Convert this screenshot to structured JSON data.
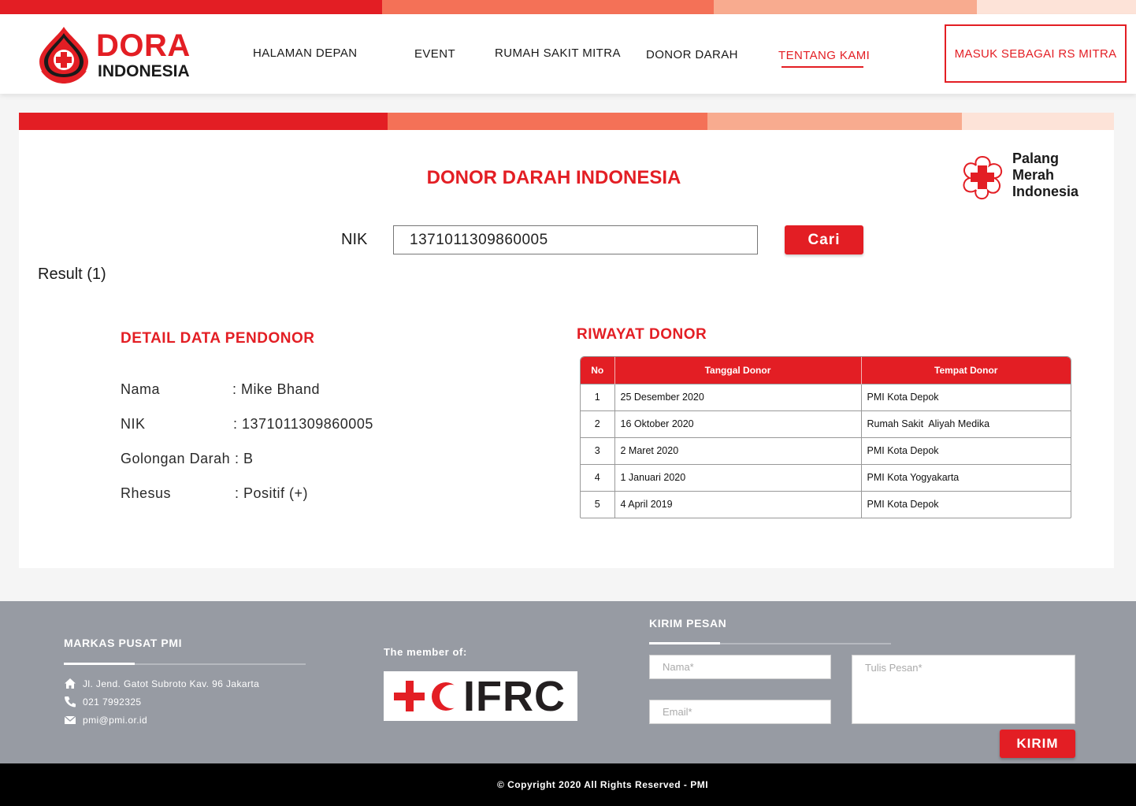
{
  "colors": {
    "primary": "#e31e24",
    "stripe": [
      "#e31e24",
      "#f47157",
      "#f8ab8f",
      "#fde3d8"
    ],
    "footer_bg": "#979ba3"
  },
  "brand": {
    "name": "DORA",
    "subtitle": "INDONESIA"
  },
  "nav": {
    "items": [
      {
        "label": "HALAMAN DEPAN"
      },
      {
        "label": "EVENT"
      },
      {
        "label": "RUMAH SAKIT MITRA"
      },
      {
        "label": "DONOR DARAH"
      },
      {
        "label": "TENTANG KAMI",
        "active": true
      }
    ],
    "login_label": "MASUK SEBAGAI RS MITRA"
  },
  "main": {
    "title": "DONOR DARAH INDONESIA",
    "pmi_logo_text": [
      "Palang",
      "Merah",
      "Indonesia"
    ],
    "search": {
      "label": "NIK",
      "value": "1371011309860005",
      "button": "Cari"
    },
    "result_count": "Result (1)"
  },
  "detail": {
    "title": "DETAIL DATA PENDONOR",
    "rows": [
      {
        "label": "Nama",
        "value": ": Mike Bhand"
      },
      {
        "label": "NIK",
        "value": ": 1371011309860005"
      },
      {
        "label": "Golongan Darah",
        "value": ": B"
      },
      {
        "label": "Rhesus",
        "value": ": Positif (+)"
      }
    ]
  },
  "history": {
    "title": "RIWAYAT DONOR",
    "columns": [
      "No",
      "Tanggal Donor",
      "Tempat Donor"
    ],
    "rows": [
      {
        "no": "1",
        "date": "25 Desember 2020",
        "place": "PMI Kota Depok"
      },
      {
        "no": "2",
        "date": "16 Oktober 2020",
        "place": "Rumah Sakit  Aliyah Medika"
      },
      {
        "no": "3",
        "date": "2 Maret 2020",
        "place": "PMI Kota Depok"
      },
      {
        "no": "4",
        "date": "1 Januari 2020",
        "place": "PMI Kota Yogyakarta"
      },
      {
        "no": "5",
        "date": "4 April 2019",
        "place": "PMI Kota Depok"
      }
    ]
  },
  "footer": {
    "hq_title": "MARKAS PUSAT PMI",
    "address": "Jl. Jend. Gatot Subroto Kav. 96 Jakarta",
    "phone": "021 7992325",
    "email": "pmi@pmi.or.id",
    "member_label": "The member of:",
    "ifrc_text": "IFRC",
    "message_title": "KIRIM PESAN",
    "name_placeholder": "Nama*",
    "email_placeholder": "Email*",
    "message_placeholder": "Tulis Pesan*",
    "send_label": "KIRIM",
    "copyright": "© Copyright 2020 All Rights Reserved - PMI"
  }
}
